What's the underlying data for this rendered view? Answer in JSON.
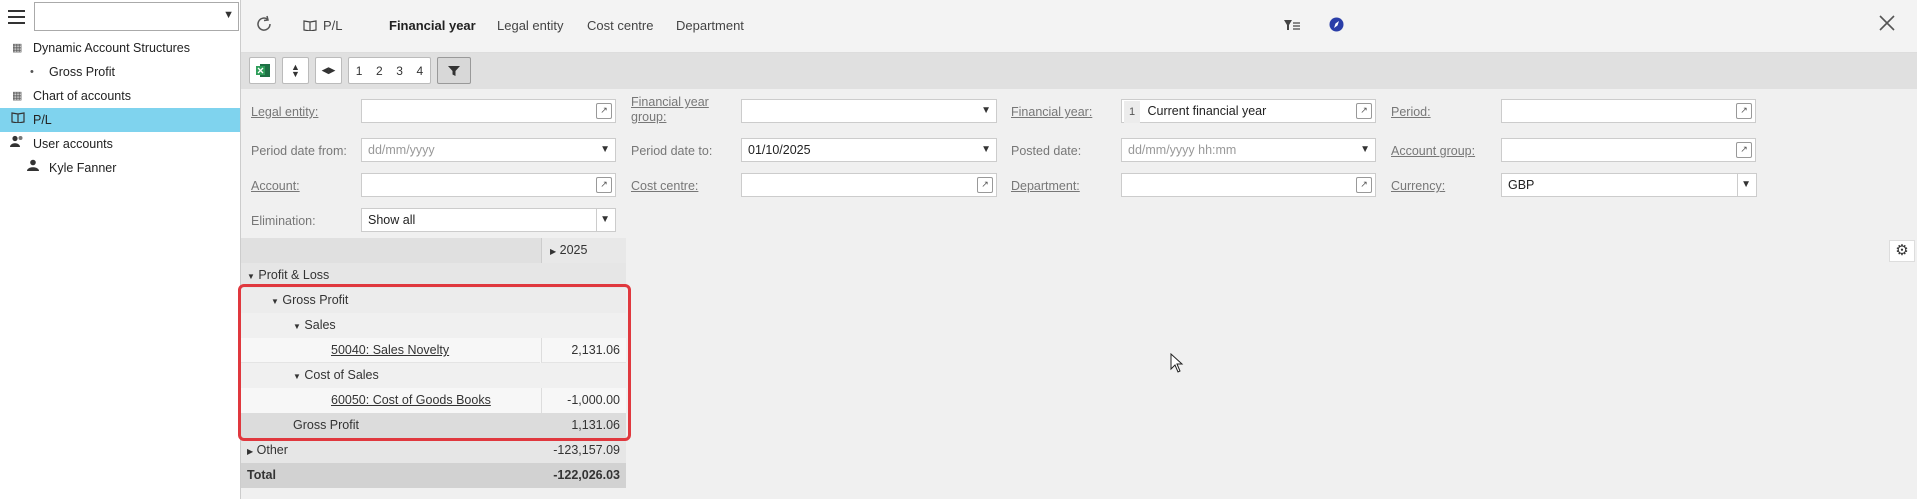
{
  "sidebar": {
    "search_value": "",
    "items": [
      {
        "label": "Dynamic Account Structures",
        "icon": "grid-icon"
      },
      {
        "label": "Gross Profit",
        "icon": "bullet-icon"
      },
      {
        "label": "Chart of accounts",
        "icon": "grid-icon"
      },
      {
        "label": "P/L",
        "icon": "book-icon"
      },
      {
        "label": "User accounts",
        "icon": "users-icon"
      },
      {
        "label": "Kyle Fanner",
        "icon": "user-icon"
      }
    ]
  },
  "toolbar": {
    "title": "P/L",
    "tabs": [
      "Financial year",
      "Legal entity",
      "Cost centre",
      "Department"
    ]
  },
  "buttons": {
    "levels": [
      "1",
      "2",
      "3",
      "4"
    ]
  },
  "filters": {
    "legal_entity_label": "Legal entity:",
    "fy_group_label": "Financial year group:",
    "financial_year_label": "Financial year:",
    "financial_year_num": "1",
    "financial_year_value": "Current financial year",
    "period_label": "Period:",
    "period_from_label": "Period date from:",
    "period_from_placeholder": "dd/mm/yyyy",
    "period_to_label": "Period date to:",
    "period_to_value": "01/10/2025",
    "posted_date_label": "Posted date:",
    "posted_date_placeholder": "dd/mm/yyyy hh:mm",
    "account_group_label": "Account group:",
    "account_label": "Account:",
    "cost_centre_label": "Cost centre:",
    "department_label": "Department:",
    "currency_label": "Currency:",
    "currency_value": "GBP",
    "elimination_label": "Elimination:",
    "elimination_value": "Show all"
  },
  "grid": {
    "column_header": "2025",
    "rows": [
      {
        "label": "Profit & Loss",
        "value": ""
      },
      {
        "label": "Gross Profit",
        "value": ""
      },
      {
        "label": "Sales",
        "value": ""
      },
      {
        "label": "50040: Sales Novelty",
        "value": "2,131.06"
      },
      {
        "label": "Cost of Sales",
        "value": ""
      },
      {
        "label": "60050: Cost of Goods Books",
        "value": "-1,000.00"
      },
      {
        "label": "Gross Profit",
        "value": "1,131.06"
      },
      {
        "label": "Other",
        "value": "-123,157.09"
      },
      {
        "label": "Total",
        "value": "-122,026.03"
      }
    ]
  },
  "colors": {
    "active_nav": "#7fd3ee",
    "highlight": "#e0383e"
  }
}
